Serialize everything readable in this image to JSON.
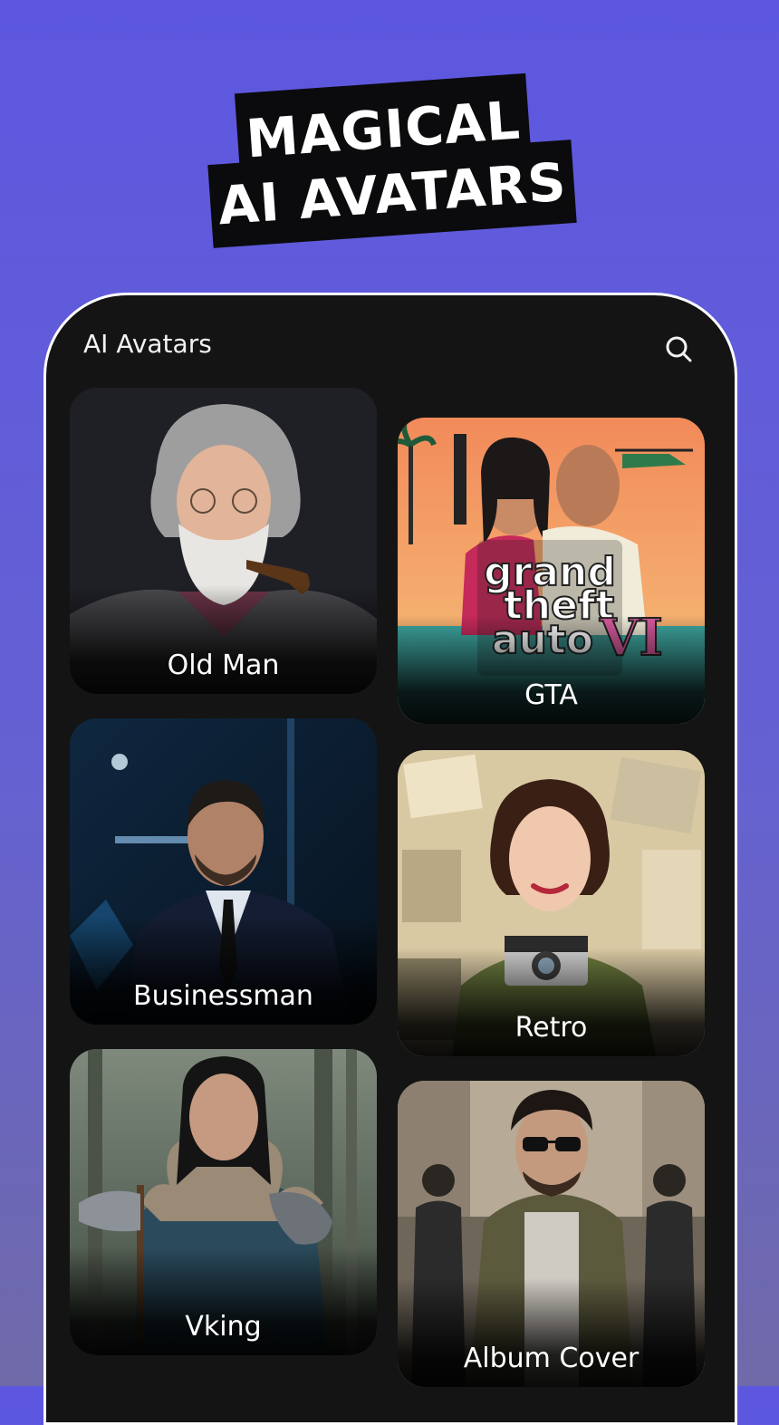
{
  "headline": {
    "line1": "MAGICAL",
    "line2": "AI AVATARS"
  },
  "app": {
    "title": "AI Avatars",
    "search_icon": "search-icon"
  },
  "cards": [
    {
      "label": "Old Man",
      "image": "old-man-avatar-image"
    },
    {
      "label": "GTA",
      "image": "gta-avatar-image"
    },
    {
      "label": "Businessman",
      "image": "businessman-avatar-image"
    },
    {
      "label": "Retro",
      "image": "retro-avatar-image"
    },
    {
      "label": "Vking",
      "image": "viking-avatar-image"
    },
    {
      "label": "Album Cover",
      "image": "album-cover-avatar-image"
    }
  ],
  "colors": {
    "background": "#5d57e0",
    "panel": "#141414",
    "headline_box": "#0b0b0d",
    "text": "#ffffff"
  }
}
